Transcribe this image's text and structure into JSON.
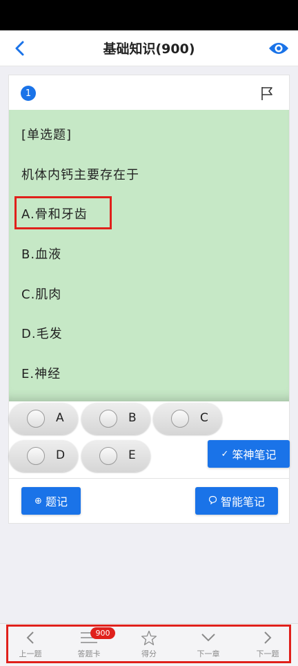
{
  "header": {
    "title": "基础知识(900)"
  },
  "question": {
    "number": "1",
    "type": "[单选题]",
    "stem": "机体内钙主要存在于",
    "options": [
      "A.骨和牙齿",
      "B.血液",
      "C.肌肉",
      "D.毛发",
      "E.神经"
    ]
  },
  "choices": [
    "A",
    "B",
    "C",
    "D",
    "E"
  ],
  "buttons": {
    "notes_label": "笨神笔记",
    "ask_label": "题记",
    "smart_notes_label": "智能笔记"
  },
  "bottom_nav": {
    "prev_question": "上一题",
    "answer_card": "答题卡",
    "answer_card_badge": "900",
    "score": "得分",
    "next_chapter": "下一章",
    "next_question": "下一题"
  },
  "colors": {
    "accent": "#1a73e8",
    "highlight": "#e0201b",
    "question_bg": "#c6e8c6"
  }
}
